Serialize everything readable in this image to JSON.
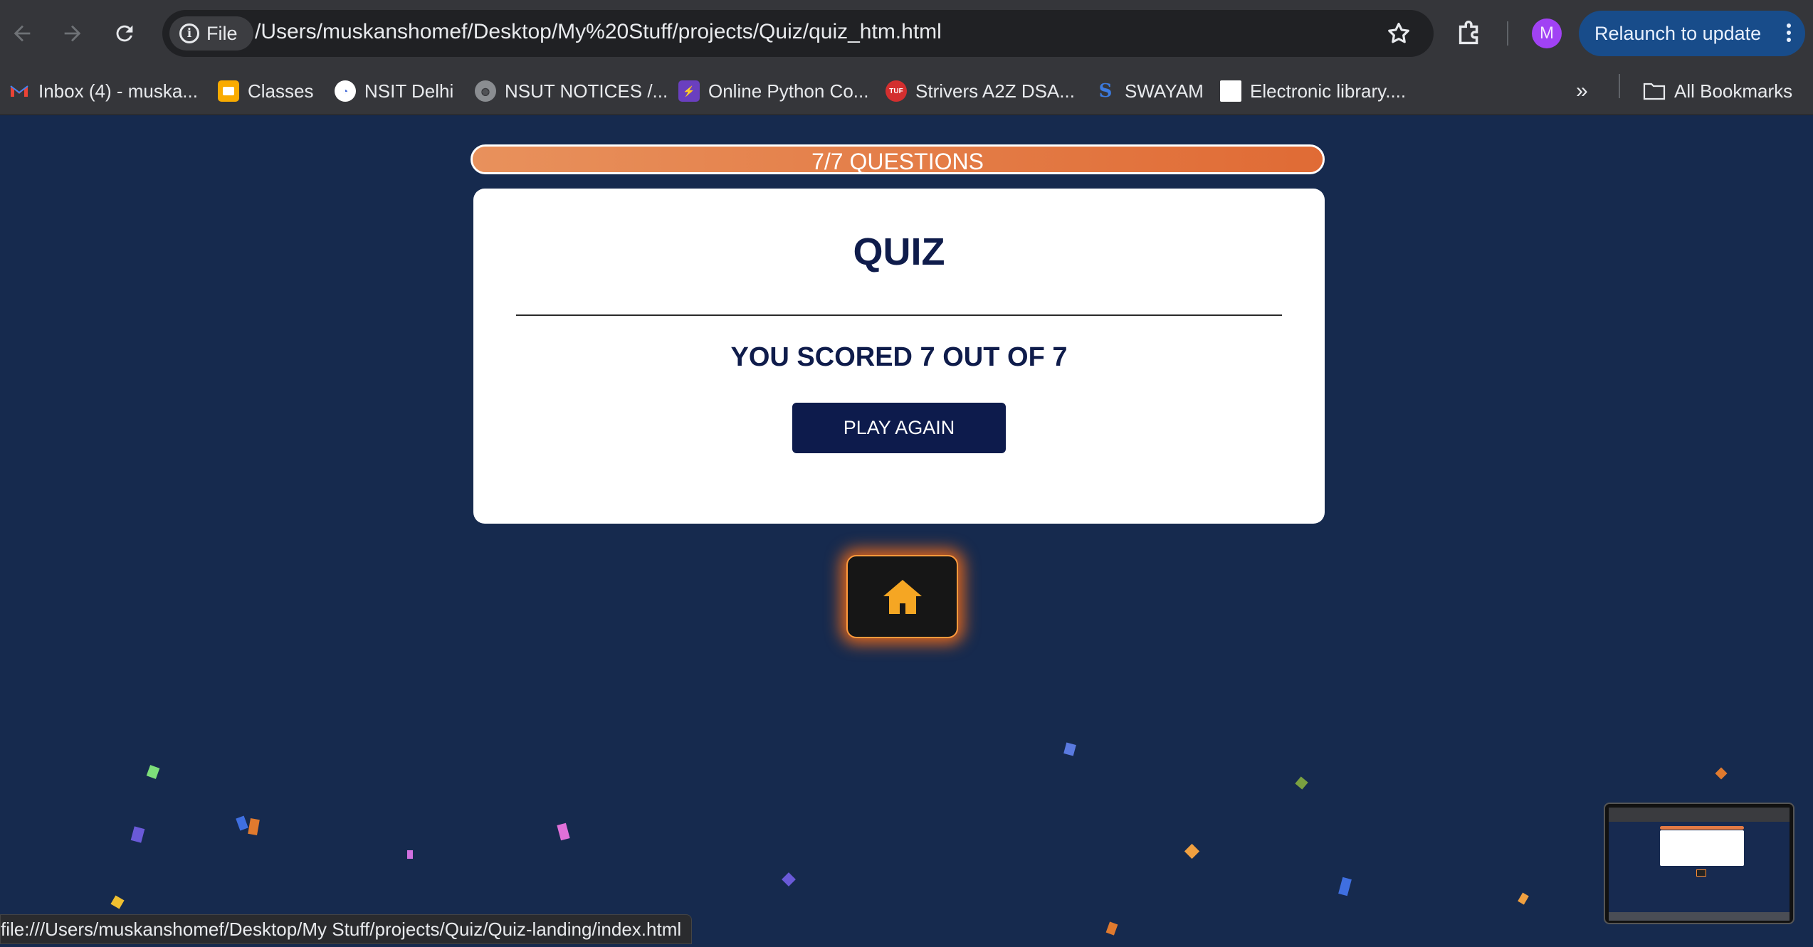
{
  "browser": {
    "secure_chip_label": "File",
    "url": "/Users/muskanshomef/Desktop/My%20Stuff/projects/Quiz/quiz_htm.html",
    "avatar_initial": "M",
    "relaunch_label": "Relaunch to update",
    "bookmarks": [
      {
        "label": "Inbox (4) - muska...",
        "icon": "gmail-icon",
        "color": "#ea4335"
      },
      {
        "label": "Classes",
        "icon": "classroom-icon",
        "color": "#f9ab00"
      },
      {
        "label": "NSIT Delhi",
        "icon": "nsit-logo-icon",
        "color": "#4a6fd8"
      },
      {
        "label": "NSUT NOTICES /...",
        "icon": "globe-icon",
        "color": "#8a8d91"
      },
      {
        "label": "Online Python Co...",
        "icon": "bolt-icon",
        "color": "#6a3fbf"
      },
      {
        "label": "Strivers A2Z DSA...",
        "icon": "tuf-icon",
        "color": "#d32f2f"
      },
      {
        "label": "SWAYAM",
        "icon": "swayam-icon",
        "color": "#3c7be0"
      },
      {
        "label": "Electronic library....",
        "icon": "page-icon",
        "color": "#ffffff"
      }
    ],
    "all_bookmarks_label": "All Bookmarks",
    "status_url": "file:///Users/muskanshomef/Desktop/My Stuff/projects/Quiz/Quiz-landing/index.html"
  },
  "quiz": {
    "progress_label": "7/7 QUESTIONS",
    "progress": 1.0,
    "title": "QUIZ",
    "score_text": "YOU SCORED 7 OUT OF 7",
    "play_again_label": "PLAY AGAIN"
  },
  "colors": {
    "page_bg": "#162a4e",
    "accent_orange": "#e37a45",
    "navy": "#0f1c4b"
  }
}
